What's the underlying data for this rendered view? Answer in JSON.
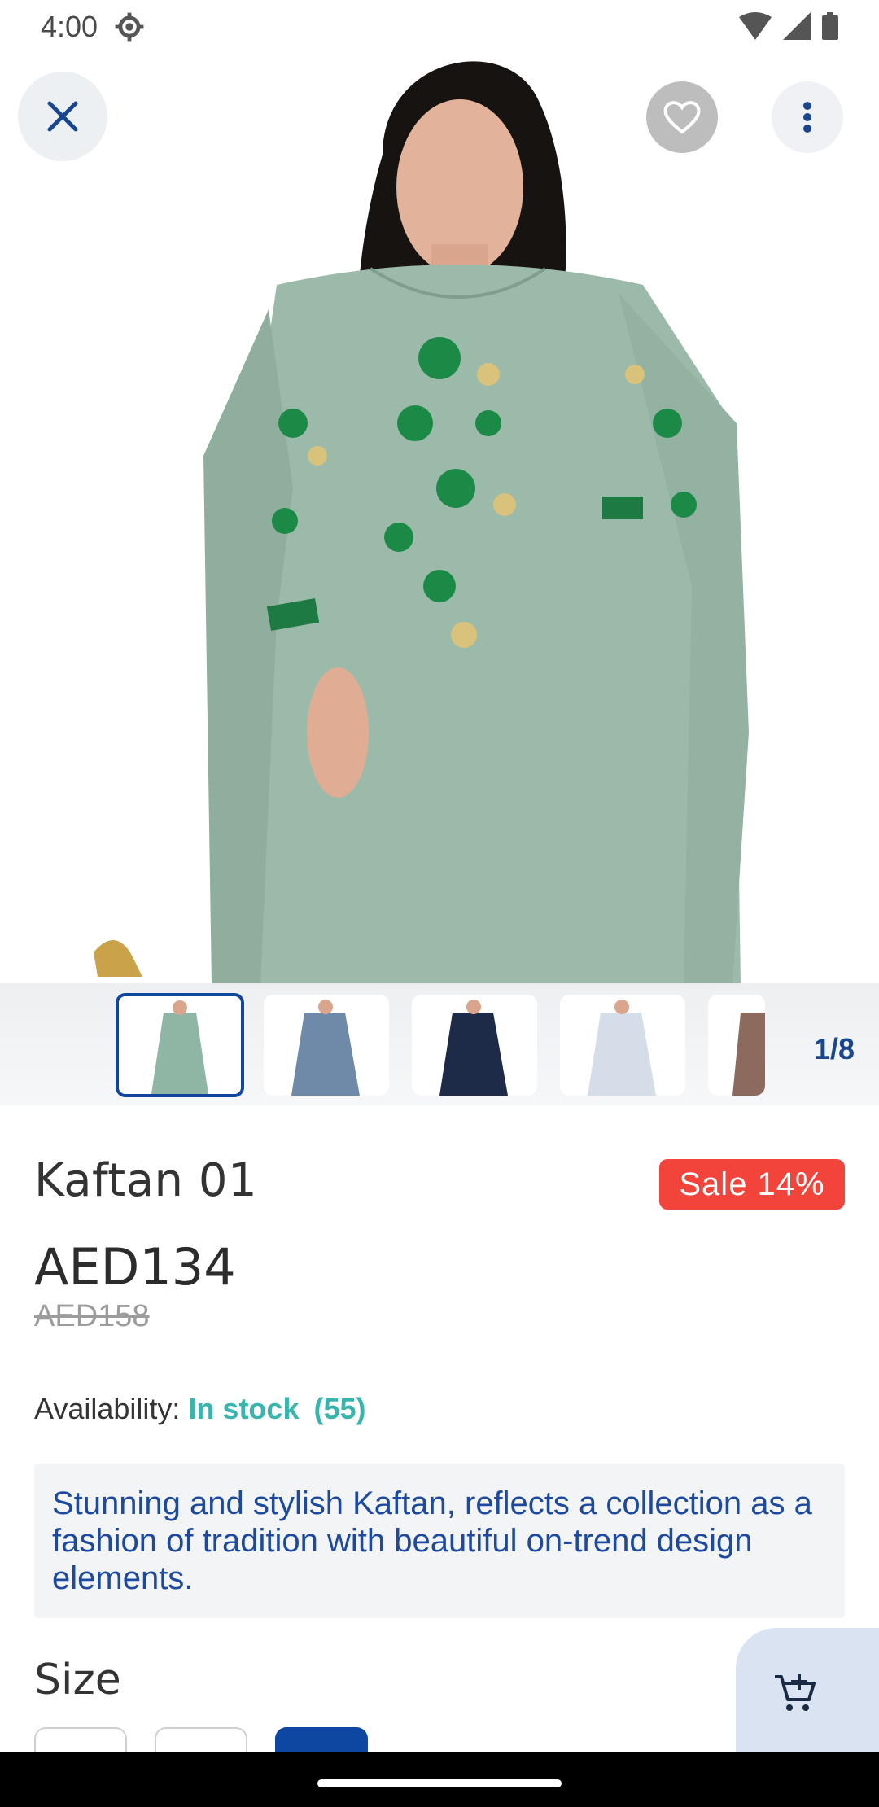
{
  "status_bar": {
    "time": "4:00",
    "icons": [
      "gear-icon",
      "wifi-icon",
      "signal-icon",
      "battery-icon"
    ]
  },
  "top_actions": {
    "close_icon": "close-icon",
    "favorite_icon": "heart-icon",
    "more_icon": "more-vert-icon"
  },
  "gallery": {
    "counter": "1/8",
    "thumbnails": [
      {
        "color": "#8fb5a5",
        "selected": true
      },
      {
        "color": "#6f8aa8",
        "selected": false
      },
      {
        "color": "#1d2a48",
        "selected": false
      },
      {
        "color": "#d4dde8",
        "selected": false
      },
      {
        "color": "#8c6a5e",
        "selected": false
      }
    ]
  },
  "product": {
    "title": "Kaftan 01",
    "sale_badge": "Sale 14%",
    "price": "AED134",
    "old_price": "AED158",
    "availability_label": "Availability:",
    "stock_status": "In stock",
    "stock_count": "(55)",
    "description": "Stunning and stylish Kaftan, reflects a collection as a fashion of tradition with beautiful on-trend design elements.",
    "size_label": "Size"
  },
  "colors": {
    "accent": "#0d47a1",
    "sale": "#f2443a",
    "stock": "#39b5ad",
    "description_text": "#1d4aa0"
  },
  "cart_button_icon": "add-to-cart-icon"
}
